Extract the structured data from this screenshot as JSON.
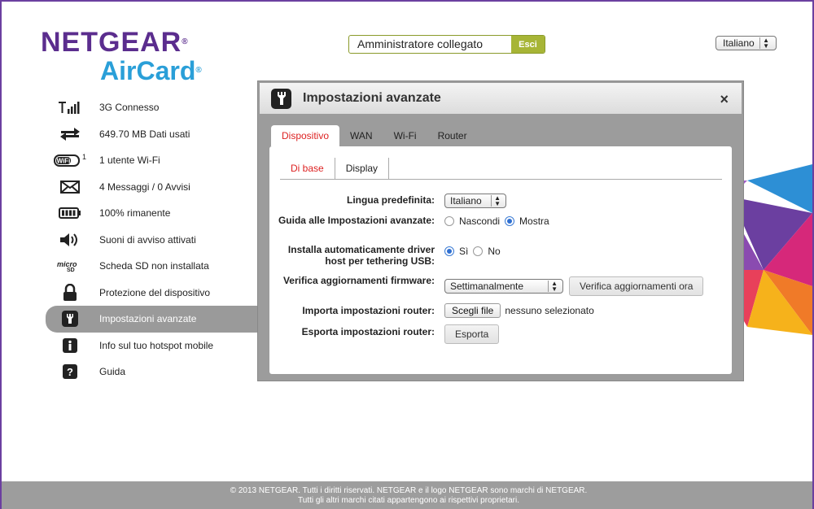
{
  "brand": {
    "name": "NETGEAR",
    "product": "AirCard",
    "reg": "®"
  },
  "header": {
    "status": "Amministratore collegato",
    "logout_label": "Esci",
    "language": "Italiano"
  },
  "sidebar": {
    "items": [
      {
        "label": "3G Connesso",
        "icon": "signal-icon"
      },
      {
        "label": "649.70 MB Dati usati",
        "icon": "data-transfer-icon"
      },
      {
        "label": "1 utente Wi-Fi",
        "icon": "wifi-icon",
        "badge": "1",
        "icon_text": "WiFi"
      },
      {
        "label": "4 Messaggi / 0 Avvisi",
        "icon": "envelope-icon"
      },
      {
        "label": "100% rimanente",
        "icon": "battery-icon"
      },
      {
        "label": "Suoni di avviso attivati",
        "icon": "speaker-icon"
      },
      {
        "label": "Scheda SD non installata",
        "icon": "microsd-icon"
      },
      {
        "label": "Protezione del dispositivo",
        "icon": "lock-icon"
      },
      {
        "label": "Impostazioni avanzate",
        "icon": "wrench-icon",
        "active": true
      },
      {
        "label": "Info sul tuo hotspot mobile",
        "icon": "info-icon"
      },
      {
        "label": "Guida",
        "icon": "help-icon"
      }
    ]
  },
  "modal": {
    "title": "Impostazioni avanzate",
    "close": "×",
    "tabs": [
      "Dispositivo",
      "WAN",
      "Wi-Fi",
      "Router"
    ],
    "subtabs": [
      "Di base",
      "Display"
    ],
    "fields": {
      "language_label": "Lingua predefinita:",
      "language_value": "Italiano",
      "guide_label": "Guida alle Impostazioni avanzate:",
      "guide_hide": "Nascondi",
      "guide_show": "Mostra",
      "driver_label": "Installa automaticamente driver host per tethering USB:",
      "driver_yes": "Sì",
      "driver_no": "No",
      "firmware_label": "Verifica aggiornamenti firmware:",
      "firmware_value": "Settimanalmente",
      "firmware_button": "Verifica aggiornamenti ora",
      "import_label": "Importa impostazioni router:",
      "import_button": "Scegli file",
      "import_status": "nessuno selezionato",
      "export_label": "Esporta impostazioni router:",
      "export_button": "Esporta"
    }
  },
  "footer": {
    "line1": "© 2013 NETGEAR. Tutti i diritti riservati. NETGEAR e il logo NETGEAR sono marchi di NETGEAR.",
    "line2": "Tutti gli altri marchi citati appartengono ai rispettivi proprietari."
  }
}
